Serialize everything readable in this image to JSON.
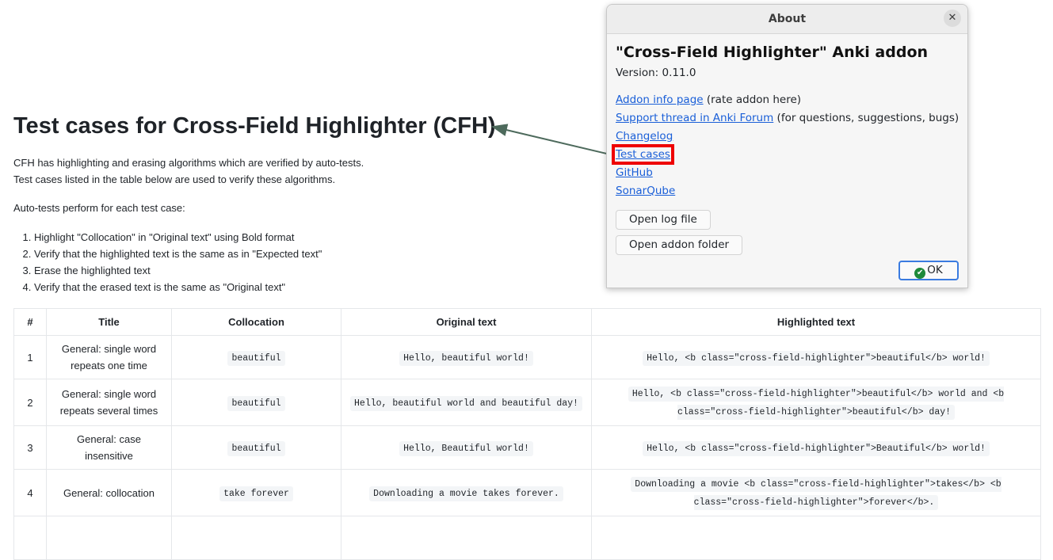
{
  "page": {
    "title": "Test cases for Cross-Field Highlighter (CFH)",
    "intro1": "CFH has highlighting and erasing algorithms which are verified by auto-tests.",
    "intro2": "Test cases listed in the table below are used to verify these algorithms.",
    "auto": "Auto-tests perform for each test case:",
    "steps": [
      "Highlight \"Collocation\" in \"Original text\" using Bold format",
      "Verify that the highlighted text is the same as in \"Expected text\"",
      "Erase the highlighted text",
      "Verify that the erased text is the same as \"Original text\""
    ]
  },
  "table": {
    "headers": [
      "#",
      "Title",
      "Collocation",
      "Original text",
      "Highlighted text"
    ],
    "rows": [
      [
        "1",
        "General: single word repeats one time",
        "beautiful",
        "Hello, beautiful world!",
        "Hello, <b class=\"cross-field-highlighter\">beautiful</b> world!"
      ],
      [
        "2",
        "General: single word repeats several times",
        "beautiful",
        "Hello, beautiful world and beautiful day!",
        "Hello, <b class=\"cross-field-highlighter\">beautiful</b> world and <b class=\"cross-field-highlighter\">beautiful</b> day!"
      ],
      [
        "3",
        "General: case insensitive",
        "beautiful",
        "Hello, Beautiful world!",
        "Hello, <b class=\"cross-field-highlighter\">Beautiful</b> world!"
      ],
      [
        "4",
        "General: collocation",
        "take forever",
        "Downloading a movie takes forever.",
        "Downloading a movie <b class=\"cross-field-highlighter\">takes</b> <b class=\"cross-field-highlighter\">forever</b>."
      ]
    ]
  },
  "dialog": {
    "window_title": "About",
    "close_icon": "close-icon",
    "title": "\"Cross-Field Highlighter\" Anki addon",
    "version": "Version: 0.11.0",
    "links": [
      {
        "label": "Addon info page",
        "note": " (rate addon here)"
      },
      {
        "label": "Support thread in Anki Forum",
        "note": " (for questions, suggestions, bugs)"
      },
      {
        "label": "Changelog",
        "note": ""
      },
      {
        "label": "Test cases",
        "note": ""
      },
      {
        "label": "GitHub",
        "note": ""
      },
      {
        "label": "SonarQube",
        "note": ""
      }
    ],
    "open_log": "Open log file",
    "open_folder": "Open addon folder",
    "ok": "OK",
    "highlight_color": "#e00000",
    "link_color": "#1a5fd8"
  }
}
